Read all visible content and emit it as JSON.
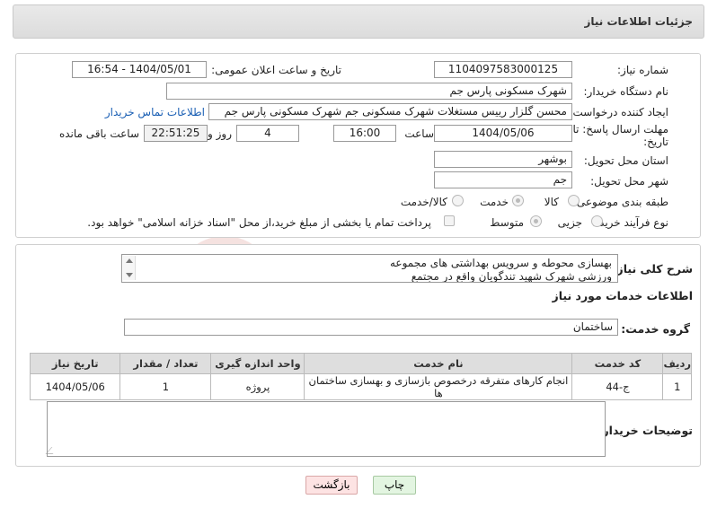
{
  "header": {
    "title": "جزئیات اطلاعات نیاز"
  },
  "form": {
    "need_number_label": "شماره نیاز:",
    "need_number": "1104097583000125",
    "announce_label": "تاریخ و ساعت اعلان عمومی:",
    "announce_value": "1404/05/01 - 16:54",
    "buyer_org_label": "نام دستگاه خریدار:",
    "buyer_org": "شهرک مسکونی پارس جم",
    "creator_label": "ایجاد کننده درخواست:",
    "creator": "محسن گلزار رییس مستغلات شهرک مسکونی جم شهرک مسکونی پارس جم",
    "contact_link": "اطلاعات تماس خریدار",
    "deadline_label": "مهلت ارسال پاسخ: تا تاریخ:",
    "deadline_date": "1404/05/06",
    "time_label": "ساعت",
    "deadline_time": "16:00",
    "days_value": "4",
    "days_label": "روز و",
    "remaining_time": "22:51:25",
    "remaining_label": "ساعت باقی مانده",
    "province_label": "استان محل تحویل:",
    "province": "بوشهر",
    "city_label": "شهر محل تحویل:",
    "city": "جم",
    "category_label": "طبقه بندی موضوعی:",
    "category_options": [
      "کالا",
      "خدمت",
      "کالا/خدمت"
    ],
    "category_selected": 1,
    "process_label": "نوع فرآیند خرید :",
    "process_options": [
      "جزیی",
      "متوسط"
    ],
    "process_selected": 1,
    "treasury_note": "پرداخت تمام یا بخشی از مبلغ خرید،از محل \"اسناد خزانه اسلامی\" خواهد بود."
  },
  "description": {
    "label": "شرح کلی نیاز:",
    "text": "بهسازی محوطه و سرویس بهداشتی های مجموعه ورزشی شهرک شهید تندگویان واقع در مجتمع"
  },
  "services": {
    "section_title": "اطلاعات خدمات مورد نیاز",
    "group_label": "گروه خدمت:",
    "group_value": "ساختمان",
    "columns": [
      "ردیف",
      "کد خدمت",
      "نام خدمت",
      "واحد اندازه گیری",
      "تعداد / مقدار",
      "تاریخ نیاز"
    ],
    "rows": [
      [
        "1",
        "ج-44",
        "انجام کارهای متفرقه درخصوص بازسازی و بهسازی ساختمان ها",
        "پروژه",
        "1",
        "1404/05/06"
      ]
    ]
  },
  "buyer_notes": {
    "label": "توضیحات خریدار:",
    "value": ""
  },
  "buttons": {
    "print": "چاپ",
    "back": "بازگشت"
  },
  "watermark": {
    "text": "AriaTender.neT"
  },
  "colors": {
    "link": "#1a5fb4",
    "header_bg": "#e2e2e2",
    "table_header_bg": "#dedede",
    "back_bg": "#fde3e3",
    "print_bg": "#e3f5e1"
  }
}
